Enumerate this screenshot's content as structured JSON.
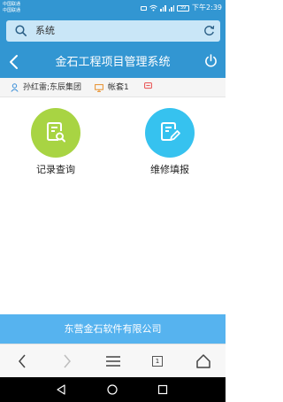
{
  "status_bar": {
    "carrier1": "中国联通",
    "carrier2": "中国联通",
    "battery": "39",
    "time": "下午2:39"
  },
  "search": {
    "text": "系统"
  },
  "header": {
    "title": "金石工程项目管理系统"
  },
  "info": {
    "user": "孙红雷;东辰集团",
    "account": "帐套1"
  },
  "features": [
    {
      "label": "记录查询",
      "color": "#a8d443"
    },
    {
      "label": "维修填报",
      "color": "#36c2ef"
    }
  ],
  "footer": {
    "company": "东营金石软件有限公司"
  },
  "browser": {
    "tab_count": "1"
  },
  "colors": {
    "primary": "#3296d2",
    "footer": "#56b3ef"
  }
}
